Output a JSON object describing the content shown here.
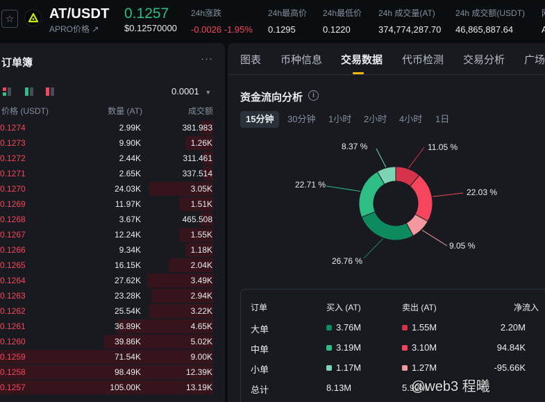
{
  "header": {
    "pair": "AT/USDT",
    "sub_name": "APRO价格 ↗",
    "price": "0.1257",
    "price_usd": "$0.12570000",
    "stats": [
      {
        "label": "24h涨跌",
        "value": "-0.0026 -1.95%",
        "negative": true
      },
      {
        "label": "24h最高价",
        "value": "0.1295"
      },
      {
        "label": "24h最低价",
        "value": "0.1220"
      },
      {
        "label": "24h 成交量(AT)",
        "value": "374,774,287.70"
      },
      {
        "label": "24h 成交额(USDT)",
        "value": "46,865,887.64"
      },
      {
        "label": "网",
        "value": "A"
      }
    ]
  },
  "orderbook": {
    "title": "订单簿",
    "more": "···",
    "precision": "0.0001",
    "columns": {
      "price": "价格 (USDT)",
      "qty": "数量 (AT)",
      "total": "成交额"
    },
    "rows": [
      {
        "price": "0.1274",
        "qty": "2.99K",
        "total": "381.983",
        "depth": 0.06
      },
      {
        "price": "0.1273",
        "qty": "9.90K",
        "total": "1.26K",
        "depth": 0.13
      },
      {
        "price": "0.1272",
        "qty": "2.44K",
        "total": "311.461",
        "depth": 0.05
      },
      {
        "price": "0.1271",
        "qty": "2.65K",
        "total": "337.514",
        "depth": 0.05
      },
      {
        "price": "0.1270",
        "qty": "24.03K",
        "total": "3.05K",
        "depth": 0.3
      },
      {
        "price": "0.1269",
        "qty": "11.97K",
        "total": "1.51K",
        "depth": 0.16
      },
      {
        "price": "0.1268",
        "qty": "3.67K",
        "total": "465.508",
        "depth": 0.06
      },
      {
        "price": "0.1267",
        "qty": "12.24K",
        "total": "1.55K",
        "depth": 0.16
      },
      {
        "price": "0.1266",
        "qty": "9.34K",
        "total": "1.18K",
        "depth": 0.13
      },
      {
        "price": "0.1265",
        "qty": "16.15K",
        "total": "2.04K",
        "depth": 0.21
      },
      {
        "price": "0.1264",
        "qty": "27.62K",
        "total": "3.49K",
        "depth": 0.31
      },
      {
        "price": "0.1263",
        "qty": "23.28K",
        "total": "2.94K",
        "depth": 0.29
      },
      {
        "price": "0.1262",
        "qty": "25.54K",
        "total": "3.22K",
        "depth": 0.3
      },
      {
        "price": "0.1261",
        "qty": "36.89K",
        "total": "4.65K",
        "depth": 0.45
      },
      {
        "price": "0.1260",
        "qty": "39.86K",
        "total": "5.02K",
        "depth": 0.51
      },
      {
        "price": "0.1259",
        "qty": "71.54K",
        "total": "9.00K",
        "depth": 1.0
      },
      {
        "price": "0.1258",
        "qty": "98.49K",
        "total": "12.39K",
        "depth": 1.0
      },
      {
        "price": "0.1257",
        "qty": "105.00K",
        "total": "13.19K",
        "depth": 1.0
      }
    ]
  },
  "panel": {
    "tabs": [
      "图表",
      "币种信息",
      "交易数据",
      "代币检测",
      "交易分析",
      "广场"
    ],
    "active_tab": "交易数据",
    "section_title": "资金流向分析",
    "periods": [
      "15分钟",
      "30分钟",
      "1小时",
      "2小时",
      "4小时",
      "1日"
    ],
    "active_period": "15分钟",
    "colors": {
      "large_in": "#0e8a5f",
      "mid_in": "#2ebd85",
      "small_in": "#7dd4b4",
      "large_out": "#d6324b",
      "mid_out": "#f6465d",
      "small_out": "#f4979f"
    }
  },
  "chart_data": {
    "type": "pie",
    "series": [
      {
        "name": "",
        "value": 11.05,
        "color": "#d6324b"
      },
      {
        "name": "",
        "value": 22.03,
        "color": "#f6465d"
      },
      {
        "name": "",
        "value": 9.05,
        "color": "#f4979f"
      },
      {
        "name": "",
        "value": 26.76,
        "color": "#0e8a5f"
      },
      {
        "name": "",
        "value": 22.71,
        "color": "#2ebd85"
      },
      {
        "name": "",
        "value": 8.37,
        "color": "#7dd4b4"
      }
    ],
    "labels": [
      "11.05 %",
      "22.03 %",
      "9.05 %",
      "26.76 %",
      "22.71 %",
      "8.37 %"
    ]
  },
  "flow_table": {
    "headers": {
      "type": "订单",
      "buy": "买入 (AT)",
      "sell": "卖出 (AT)",
      "net": "净流入"
    },
    "rows": [
      {
        "type": "大单",
        "buy": "3.76M",
        "sell": "1.55M",
        "net": "2.20M"
      },
      {
        "type": "中单",
        "buy": "3.19M",
        "sell": "3.10M",
        "net": "94.84K"
      },
      {
        "type": "小单",
        "buy": "1.17M",
        "sell": "1.27M",
        "net": "-95.66K"
      },
      {
        "type": "总计",
        "buy": "8.13M",
        "sell": "5.92M",
        "net": ""
      }
    ]
  },
  "watermark": "@web3 程曦"
}
